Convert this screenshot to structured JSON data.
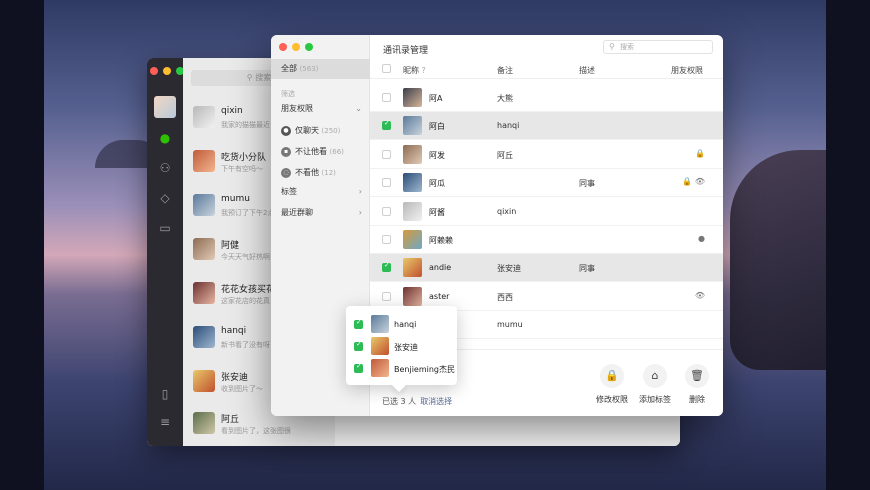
{
  "back_window": {
    "search_placeholder": "搜索",
    "chats": [
      {
        "name": "qixin",
        "message": "我家的猫猫最近"
      },
      {
        "name": "吃货小分队",
        "message": "下午有空吗～"
      },
      {
        "name": "mumu",
        "message": "我预订了下午2点"
      },
      {
        "name": "阿健",
        "message": "今天天气好热啊"
      },
      {
        "name": "花花女孩买花群",
        "message": "这家花店的花真"
      },
      {
        "name": "hanqi",
        "message": "新书看了没有呀"
      },
      {
        "name": "张安迪",
        "message": "收到图片了～"
      },
      {
        "name": "阿丘",
        "message": "看到图片了，这张图很"
      }
    ]
  },
  "front_window": {
    "title": "通讯录管理",
    "search_placeholder": "搜索",
    "left_panel": {
      "all_label": "全部",
      "all_count": "(563)",
      "filter_header": "筛选",
      "items": [
        {
          "label": "朋友权限",
          "count": "",
          "icon": "chevron-down"
        },
        {
          "label": "仅聊天",
          "count": "(250)",
          "icon": "chat-only"
        },
        {
          "label": "不让他看",
          "count": "(66)",
          "icon": "lock"
        },
        {
          "label": "不看他",
          "count": "(12)",
          "icon": "eye-off"
        },
        {
          "label": "标签",
          "count": "",
          "icon": "chevron-right"
        },
        {
          "label": "最近群聊",
          "count": "",
          "icon": "chevron-right"
        }
      ]
    },
    "table": {
      "headers": {
        "nickname": "昵称",
        "remark": "备注",
        "description": "描述",
        "permission": "朋友权限"
      },
      "rows": [
        {
          "name": "阿A",
          "remark": "大熊",
          "desc": "",
          "perm": "",
          "checked": false
        },
        {
          "name": "阿白",
          "remark": "hanqi",
          "desc": "",
          "perm": "",
          "checked": true
        },
        {
          "name": "阿发",
          "remark": "阿丘",
          "desc": "",
          "perm": "🔒",
          "checked": false
        },
        {
          "name": "阿瓜",
          "remark": "",
          "desc": "同事",
          "perm": "🔒 👁",
          "checked": false
        },
        {
          "name": "阿酱",
          "remark": "qixin",
          "desc": "",
          "perm": "",
          "checked": false
        },
        {
          "name": "阿赖赖",
          "remark": "",
          "desc": "",
          "perm": "●",
          "checked": false
        },
        {
          "name": "andie",
          "remark": "张安迪",
          "desc": "同事",
          "perm": "",
          "checked": true
        },
        {
          "name": "aster",
          "remark": "西西",
          "desc": "",
          "perm": "👁",
          "checked": false
        },
        {
          "name": "",
          "remark": "mumu",
          "desc": "",
          "perm": "",
          "checked": false
        }
      ]
    },
    "footer": {
      "selected_text": "已选 3 人",
      "cancel_select": "取消选择",
      "actions": [
        {
          "label": "修改权限",
          "icon": "lock-icon",
          "glyph": "🔒"
        },
        {
          "label": "添加标签",
          "icon": "tag-icon",
          "glyph": "⌂"
        },
        {
          "label": "删除",
          "icon": "trash-icon",
          "glyph": "🗑"
        }
      ]
    },
    "popover": [
      {
        "name": "hanqi"
      },
      {
        "name": "张安迪"
      },
      {
        "name": "Benjieming杰民"
      }
    ]
  },
  "colors": {
    "accent_green": "#2dbb55",
    "link_blue": "#576b95"
  }
}
